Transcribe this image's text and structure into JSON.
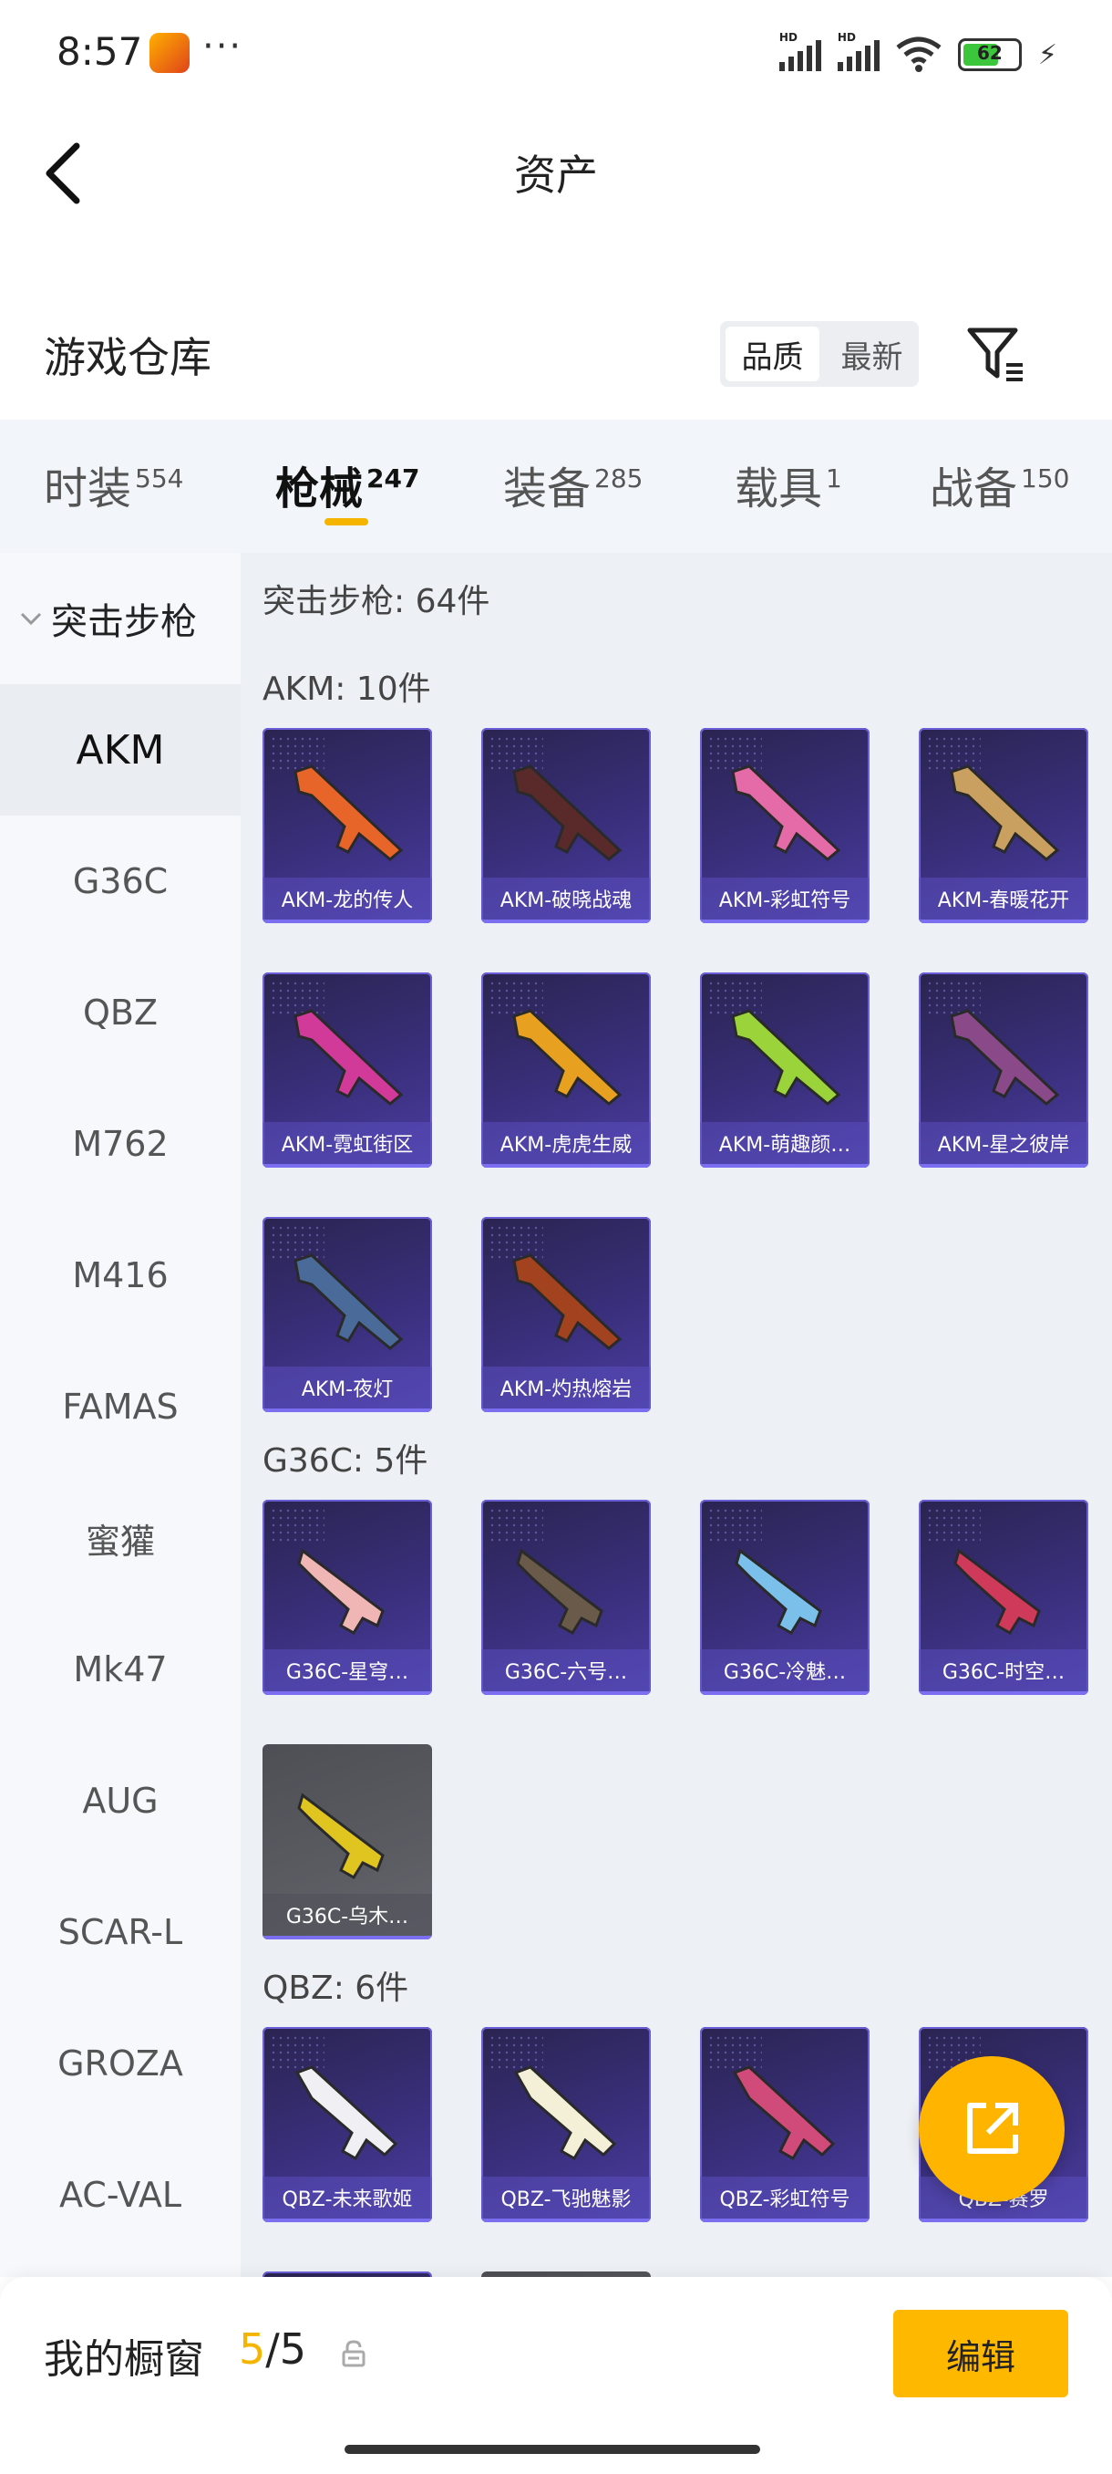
{
  "status": {
    "time": "8:57",
    "battery": "62",
    "signal_label": "HD"
  },
  "header": {
    "title": "资产"
  },
  "warehouse": {
    "title": "游戏仓库",
    "sort": [
      "品质",
      "最新"
    ]
  },
  "tabs": [
    {
      "label": "时装",
      "count": "554"
    },
    {
      "label": "枪械",
      "count": "247"
    },
    {
      "label": "装备",
      "count": "285"
    },
    {
      "label": "载具",
      "count": "1"
    },
    {
      "label": "战备",
      "count": "150"
    }
  ],
  "sidebar": {
    "category": "突击步枪",
    "items": [
      "AKM",
      "G36C",
      "QBZ",
      "M762",
      "M416",
      "FAMAS",
      "蜜獾",
      "Mk47",
      "AUG",
      "SCAR-L",
      "GROZA",
      "AC-VAL"
    ]
  },
  "content": {
    "title": "突击步枪: 64件",
    "groups": [
      {
        "title": "AKM: 10件",
        "items": [
          "AKM-龙的传人",
          "AKM-破晓战魂",
          "AKM-彩虹符号",
          "AKM-春暖花开",
          "AKM-霓虹街区",
          "AKM-虎虎生威",
          "AKM-萌趣颜…",
          "AKM-星之彼岸",
          "AKM-夜灯",
          "AKM-灼热熔岩"
        ]
      },
      {
        "title": "G36C: 5件",
        "items": [
          "G36C-星穹…",
          "G36C-六号…",
          "G36C-冷魅…",
          "G36C-时空…",
          "G36C-乌木…"
        ]
      },
      {
        "title": "QBZ: 6件",
        "items": [
          "QBZ-未来歌姬",
          "QBZ-飞驰魅影",
          "QBZ-彩虹符号",
          "QBZ-赛罗"
        ]
      }
    ]
  },
  "bottom": {
    "label": "我的橱窗",
    "current": "5",
    "total": "/5",
    "edit": "编辑"
  },
  "colors": {
    "accent": "#f5b400",
    "card_bg": "#3a2f7c",
    "sidebar_bg": "#f6f8fb",
    "content_bg": "#edf0f4"
  }
}
